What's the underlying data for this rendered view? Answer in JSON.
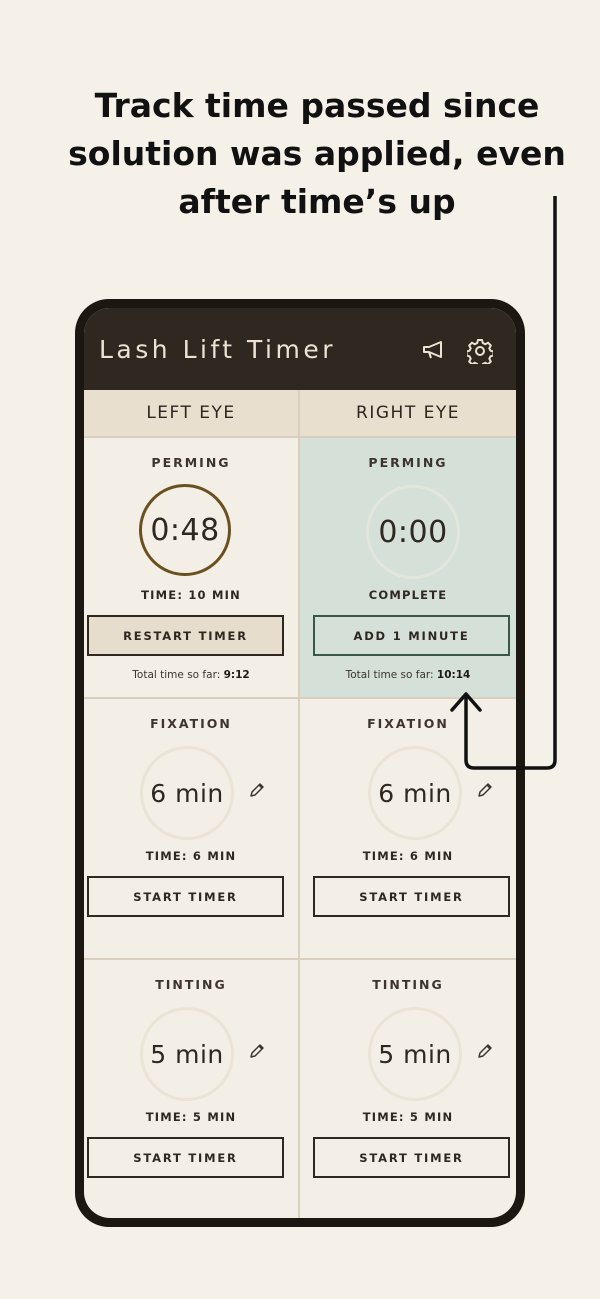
{
  "headline": {
    "line1": "Track time passed since",
    "line2": "solution was applied, even",
    "line3": "after time’s up"
  },
  "app": {
    "title": "Lash Lift Timer",
    "icons": [
      "megaphone-icon",
      "gear-icon"
    ]
  },
  "columns": [
    {
      "header": "LEFT EYE",
      "steps": [
        {
          "title": "PERMING",
          "display": "0:48",
          "time_label": "TIME: 10 MIN",
          "button": "RESTART TIMER",
          "total_prefix": "Total time so far:",
          "total_value": "9:12"
        },
        {
          "title": "FIXATION",
          "display": "6 min",
          "time_label": "TIME: 6 MIN",
          "button": "START TIMER"
        },
        {
          "title": "TINTING",
          "display": "5 min",
          "time_label": "TIME: 5 MIN",
          "button": "START TIMER"
        }
      ]
    },
    {
      "header": "RIGHT EYE",
      "steps": [
        {
          "title": "PERMING",
          "display": "0:00",
          "time_label": "COMPLETE",
          "button": "ADD 1 MINUTE",
          "total_prefix": "Total time so far:",
          "total_value": "10:14"
        },
        {
          "title": "FIXATION",
          "display": "6 min",
          "time_label": "TIME: 6 MIN",
          "button": "START TIMER"
        },
        {
          "title": "TINTING",
          "display": "5 min",
          "time_label": "TIME: 5 MIN",
          "button": "START TIMER"
        }
      ]
    }
  ],
  "colors": {
    "background": "#f6f1e8",
    "appbar": "#2f2820",
    "complete_bg": "#d4e0d8",
    "ring_progress": "#6a4f1f"
  }
}
